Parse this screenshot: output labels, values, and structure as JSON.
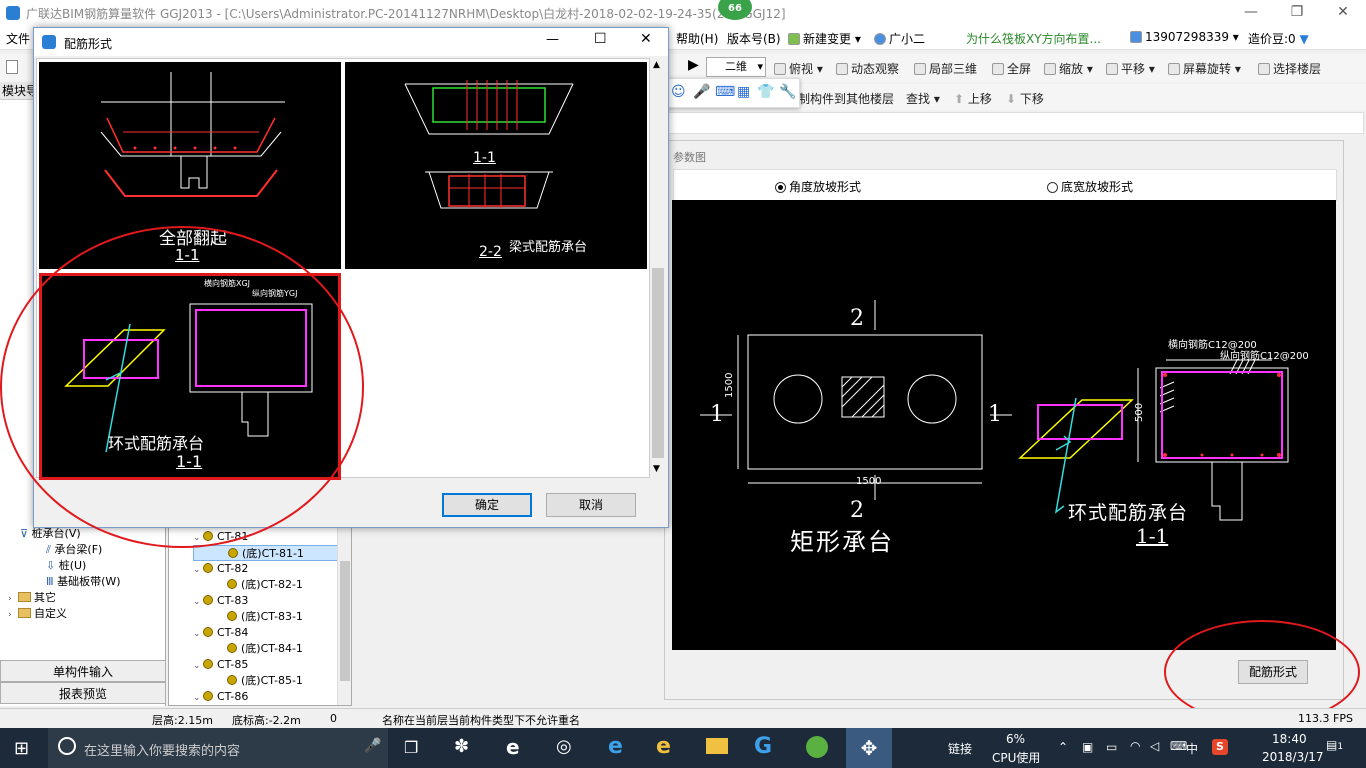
{
  "window": {
    "title": "广联达BIM钢筋算量软件 GGJ2013 - [C:\\Users\\Administrator.PC-20141127NRHM\\Desktop\\白龙村-2018-02-02-19-24-35(20...GGJ12]",
    "badge": "66"
  },
  "menu": {
    "file": "文件",
    "help": "帮助(H)",
    "version": "版本号(B)",
    "new_change": "新建变更",
    "guangxiaoer": "广小二",
    "question": "为什么筏板XY方向布置...",
    "phone": "13907298339",
    "coins": "造价豆:0"
  },
  "toolbar1": {
    "view_mode": "二维",
    "top_view": "俯视",
    "dynamic": "动态观察",
    "local3d": "局部三维",
    "fullscreen": "全屏",
    "zoom": "缩放",
    "pan": "平移",
    "rotate": "屏幕旋转",
    "select_floor": "选择楼层"
  },
  "toolbar2": {
    "copy_to_floor": "制构件到其他楼层",
    "find": "查找",
    "move_up": "上移",
    "move_down": "下移"
  },
  "left": {
    "module_label": "模块导",
    "items": [
      {
        "label": "桩承台(V)"
      },
      {
        "label": "承台梁(F)"
      },
      {
        "label": "桩(U)"
      },
      {
        "label": "基础板带(W)"
      },
      {
        "label": "其它"
      },
      {
        "label": "自定义"
      }
    ],
    "single_input": "单构件输入",
    "report_preview": "报表预览"
  },
  "tree": {
    "rows": [
      {
        "label": "CT-81",
        "level": 0
      },
      {
        "label": "(底)CT-81-1",
        "level": 1,
        "selected": true
      },
      {
        "label": "CT-82",
        "level": 0
      },
      {
        "label": "(底)CT-82-1",
        "level": 1
      },
      {
        "label": "CT-83",
        "level": 0
      },
      {
        "label": "(底)CT-83-1",
        "level": 1
      },
      {
        "label": "CT-84",
        "level": 0
      },
      {
        "label": "(底)CT-84-1",
        "level": 1
      },
      {
        "label": "CT-85",
        "level": 0
      },
      {
        "label": "(底)CT-85-1",
        "level": 1
      },
      {
        "label": "CT-86",
        "level": 0
      }
    ]
  },
  "param": {
    "header": "参数图",
    "radio_angle": "角度放坡形式",
    "radio_width": "底宽放坡形式",
    "rect_title": "矩形承台",
    "section_num": "2",
    "side_num": "1",
    "dim_1500": "1500",
    "dim_500": "500",
    "horiz_rebar": "横向钢筋C12@200",
    "long_rebar": "纵向钢筋C12@200",
    "ring_title": "环式配筋承台",
    "section_label": "1-1",
    "btn": "配筋形式"
  },
  "dialog": {
    "title": "配筋形式",
    "thumb1_title": "全部翻起",
    "thumb1_section": "1-1",
    "thumb2_section_a": "1-1",
    "thumb2_section_b": "2-2",
    "thumb2_title": "梁式配筋承台",
    "thumb3_title": "环式配筋承台",
    "thumb3_section": "1-1",
    "thumb3_h": "横向钢筋XGJ",
    "thumb3_v": "纵向钢筋YGJ",
    "ok": "确定",
    "cancel": "取消"
  },
  "status": {
    "floor_height": "层高:2.15m",
    "bottom_elev": "底标高:-2.2m",
    "zero": "0",
    "message": "名称在当前层当前构件类型下不允许重名",
    "fps": "113.3 FPS"
  },
  "taskbar": {
    "search": "在这里输入你要搜索的内容",
    "link": "链接",
    "cpu_pct": "6%",
    "cpu_label": "CPU使用",
    "ime": "中",
    "time": "18:40",
    "date": "2018/3/17",
    "notif": "1"
  },
  "colors": {
    "annotation_red": "#e0191c",
    "accent": "#0078d7",
    "taskbar": "#1c2a3a"
  }
}
